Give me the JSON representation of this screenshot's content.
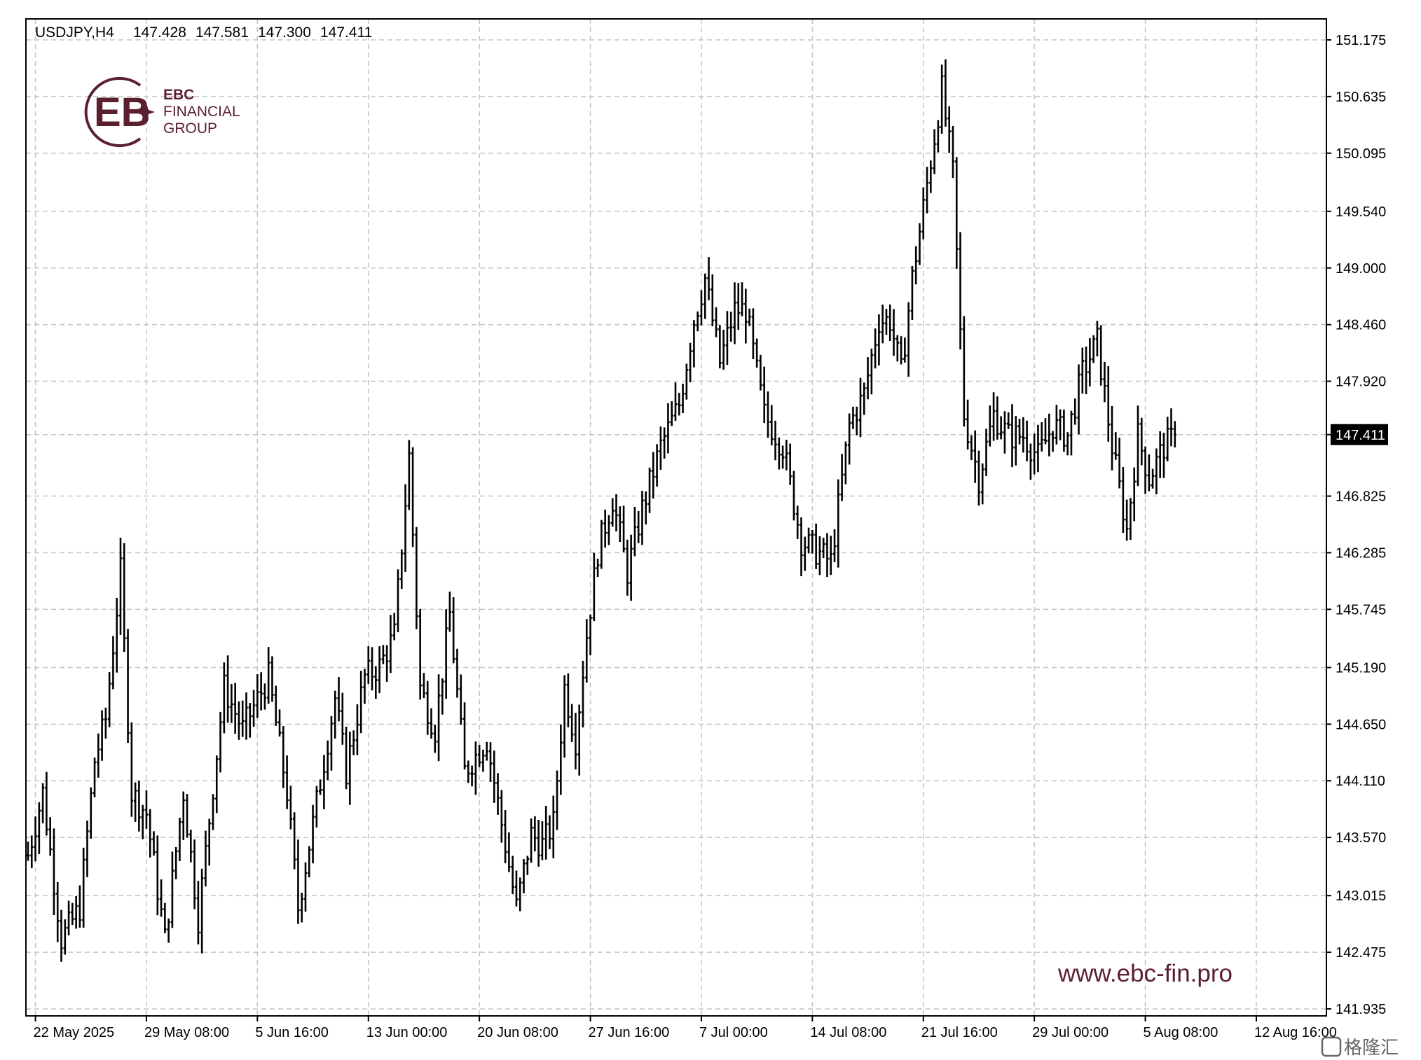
{
  "header": {
    "symbol": "USDJPY,H4",
    "open": "147.428",
    "high": "147.581",
    "low": "147.300",
    "close": "147.411"
  },
  "logo": {
    "line1": "EBC",
    "line2": "FINANCIAL",
    "line3": "GROUP",
    "color": "#5b1f2e"
  },
  "website": "www.ebc-fin.pro",
  "corner_watermark": "格隆汇",
  "chart_data": {
    "type": "ohlc",
    "symbol": "USDJPY",
    "timeframe": "H4",
    "y_ticks": [
      "151.175",
      "150.635",
      "150.095",
      "149.540",
      "149.000",
      "148.460",
      "147.920",
      "147.411",
      "146.825",
      "146.285",
      "145.745",
      "145.190",
      "144.650",
      "144.110",
      "143.570",
      "143.015",
      "142.475",
      "141.935"
    ],
    "y_tick_values": [
      151.175,
      150.635,
      150.095,
      149.54,
      149.0,
      148.46,
      147.92,
      147.411,
      146.825,
      146.285,
      145.745,
      145.19,
      144.65,
      144.11,
      143.57,
      143.015,
      142.475,
      141.935
    ],
    "current_price": "147.411",
    "ylim": [
      141.9,
      151.4
    ],
    "x_ticks": [
      "22 May 2025",
      "29 May 08:00",
      "5 Jun 16:00",
      "13 Jun 00:00",
      "20 Jun 08:00",
      "27 Jun 16:00",
      "7 Jul 00:00",
      "14 Jul 08:00",
      "21 Jul 16:00",
      "29 Jul 00:00",
      "5 Aug 08:00",
      "12 Aug 16:00"
    ],
    "grid": true,
    "bars_per_x_tick": 30,
    "pivots": [
      [
        0,
        143.4
      ],
      [
        4,
        144.0
      ],
      [
        9,
        142.6
      ],
      [
        14,
        142.9
      ],
      [
        18,
        144.3
      ],
      [
        21,
        144.7
      ],
      [
        25,
        146.1
      ],
      [
        28,
        144.0
      ],
      [
        32,
        143.8
      ],
      [
        37,
        142.6
      ],
      [
        42,
        144.0
      ],
      [
        46,
        142.8
      ],
      [
        53,
        145.0
      ],
      [
        58,
        144.6
      ],
      [
        65,
        145.1
      ],
      [
        70,
        144.0
      ],
      [
        73,
        142.9
      ],
      [
        78,
        143.9
      ],
      [
        83,
        144.9
      ],
      [
        86,
        144.2
      ],
      [
        91,
        145.1
      ],
      [
        95,
        145.2
      ],
      [
        99,
        145.5
      ],
      [
        103,
        147.2
      ],
      [
        106,
        145.0
      ],
      [
        110,
        144.6
      ],
      [
        114,
        145.7
      ],
      [
        118,
        144.2
      ],
      [
        124,
        144.5
      ],
      [
        128,
        143.7
      ],
      [
        132,
        142.9
      ],
      [
        136,
        143.6
      ],
      [
        139,
        143.5
      ],
      [
        142,
        143.7
      ],
      [
        145,
        145.0
      ],
      [
        148,
        144.5
      ],
      [
        151,
        145.5
      ],
      [
        154,
        146.3
      ],
      [
        158,
        146.8
      ],
      [
        162,
        146.1
      ],
      [
        166,
        146.7
      ],
      [
        171,
        147.3
      ],
      [
        176,
        147.7
      ],
      [
        180,
        148.5
      ],
      [
        183,
        148.9
      ],
      [
        187,
        148.1
      ],
      [
        191,
        148.6
      ],
      [
        194,
        148.6
      ],
      [
        199,
        147.6
      ],
      [
        204,
        147.3
      ],
      [
        209,
        146.4
      ],
      [
        213,
        146.3
      ],
      [
        217,
        146.2
      ],
      [
        222,
        147.5
      ],
      [
        226,
        147.8
      ],
      [
        230,
        148.5
      ],
      [
        233,
        148.5
      ],
      [
        236,
        148.0
      ],
      [
        239,
        148.9
      ],
      [
        243,
        149.8
      ],
      [
        247,
        150.7
      ],
      [
        250,
        149.9
      ],
      [
        253,
        147.6
      ],
      [
        257,
        147.0
      ],
      [
        261,
        147.6
      ],
      [
        265,
        147.4
      ],
      [
        269,
        147.4
      ],
      [
        273,
        147.2
      ],
      [
        277,
        147.5
      ],
      [
        281,
        147.4
      ],
      [
        285,
        148.0
      ],
      [
        289,
        148.3
      ],
      [
        293,
        147.3
      ],
      [
        297,
        146.5
      ],
      [
        300,
        147.4
      ],
      [
        303,
        147.0
      ],
      [
        307,
        147.3
      ],
      [
        310,
        147.4
      ]
    ]
  }
}
